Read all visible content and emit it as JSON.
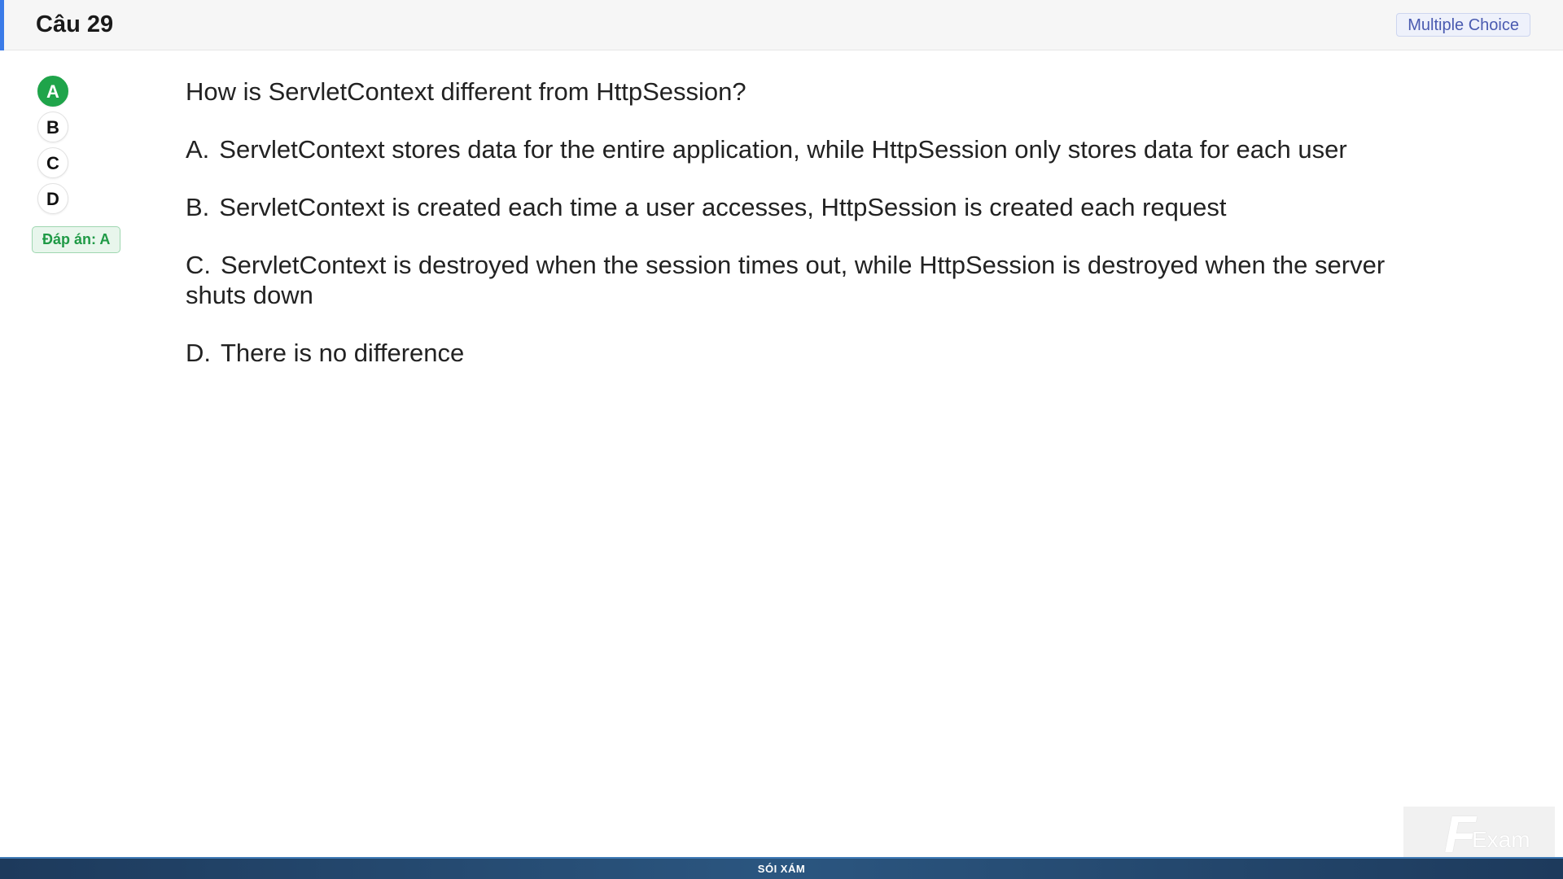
{
  "header": {
    "title": "Câu 29",
    "type_badge": "Multiple Choice"
  },
  "options": [
    {
      "letter": "A",
      "selected": true
    },
    {
      "letter": "B",
      "selected": false
    },
    {
      "letter": "C",
      "selected": false
    },
    {
      "letter": "D",
      "selected": false
    }
  ],
  "answer_badge": "Đáp án: A",
  "question": {
    "text": "How is ServletContext different from HttpSession?",
    "choices": [
      {
        "letter": "A.",
        "text": "ServletContext stores data for the entire application, while HttpSession only stores data for each user"
      },
      {
        "letter": "B.",
        "text": "ServletContext is created each time a user accesses, HttpSession is created each request"
      },
      {
        "letter": "C.",
        "text": "ServletContext is destroyed when the session times out, while HttpSession is destroyed when the server shuts down"
      },
      {
        "letter": "D.",
        "text": "There is no difference"
      }
    ]
  },
  "logo": {
    "letter": "F",
    "text": "Exam"
  },
  "footer": {
    "text": "SÓI XÁM"
  },
  "colors": {
    "accent": "#3b7be8",
    "selected": "#1fa44a",
    "badge_blue": "#4a5bb0",
    "footer": "#1d3a5c"
  }
}
